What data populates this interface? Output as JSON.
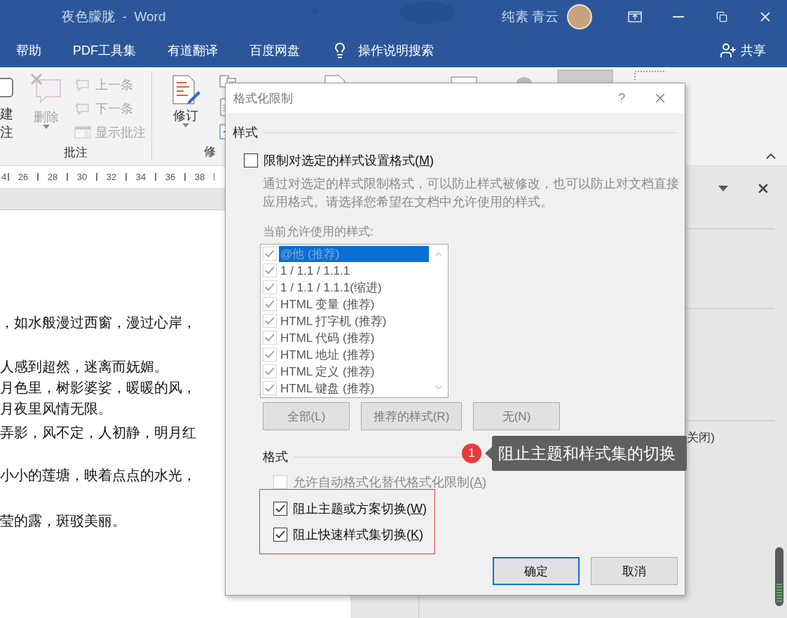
{
  "window": {
    "title": "夜色朦胧",
    "separator": "-",
    "app": "Word",
    "user": "纯素 青云"
  },
  "menu": [
    {
      "label": "帮助"
    },
    {
      "label": "PDF工具集"
    },
    {
      "label": "有道翻译"
    },
    {
      "label": "百度网盘"
    }
  ],
  "search": {
    "label": "操作说明搜索"
  },
  "share": {
    "label": "共享"
  },
  "ribbon": {
    "new_comment": {
      "lines": [
        "建",
        "注"
      ]
    },
    "delete": {
      "label": "删除",
      "disabled": true
    },
    "nav": [
      {
        "label": "上一条",
        "disabled": true
      },
      {
        "label": "下一条",
        "disabled": true
      },
      {
        "label": "显示批注",
        "disabled": true
      }
    ],
    "track": {
      "label": "修订"
    },
    "groups": [
      {
        "label": "批注"
      },
      {
        "label": "修"
      }
    ]
  },
  "ruler": [
    "4",
    "26",
    "28",
    "30",
    "32",
    "34",
    "36",
    "38"
  ],
  "document": {
    "lines": [
      {
        "text": "，如水般漫过西窗，漫过心岸，"
      },
      {
        "text": "人感到超然，迷离而妩媚。"
      },
      {
        "text": "月色里，树影婆娑，暖暖的风，"
      },
      {
        "text": "月夜里风情无限。"
      },
      {
        "text": "弄影，风不定，人初静，明月红"
      },
      {
        "text": "小小的莲塘，映着点点的水光，"
      },
      {
        "text": "莹的露，斑驳美丽。"
      }
    ]
  },
  "task_pane": {
    "text": "关闭)"
  },
  "dialog": {
    "title": "格式化限制",
    "help": "?",
    "styles": {
      "heading": "样式",
      "limit": {
        "label": "限制对选定的样式设置格式(",
        "hotkey": "M",
        "tail": ")",
        "checked": false
      },
      "description": "通过对选定的样式限制格式，可以防止样式被修改，也可以防止对文档直接应用格式。请选择您希望在文档中允许使用的样式。",
      "list_label": "当前允许使用的样式:",
      "items": [
        {
          "label": "@他 (推荐)",
          "checked": true,
          "selected": true
        },
        {
          "label": "1 / 1.1 / 1.1.1",
          "checked": true,
          "selected": false
        },
        {
          "label": "1 / 1.1 / 1.1.1(缩进)",
          "checked": true,
          "selected": false
        },
        {
          "label": "HTML 变量 (推荐)",
          "checked": true,
          "selected": false
        },
        {
          "label": "HTML 打字机 (推荐)",
          "checked": true,
          "selected": false
        },
        {
          "label": "HTML 代码 (推荐)",
          "checked": true,
          "selected": false
        },
        {
          "label": "HTML 地址 (推荐)",
          "checked": true,
          "selected": false
        },
        {
          "label": "HTML 定义 (推荐)",
          "checked": true,
          "selected": false
        },
        {
          "label": "HTML 键盘 (推荐)",
          "checked": true,
          "selected": false
        }
      ],
      "buttons": [
        {
          "label": "全部(L)",
          "disabled": true
        },
        {
          "label": "推荐的样式(R)",
          "disabled": true
        },
        {
          "label": "无(N)",
          "disabled": true
        }
      ]
    },
    "format": {
      "heading": "格式",
      "options": [
        {
          "label": "允许自动格式化替代格式化限制(",
          "hotkey": "A",
          "tail": ")",
          "checked": false,
          "disabled": true
        },
        {
          "label": "阻止主题或方案切换(",
          "hotkey": "W",
          "tail": ")",
          "checked": true,
          "disabled": false
        },
        {
          "label": "阻止快速样式集切换(",
          "hotkey": "K",
          "tail": ")",
          "checked": true,
          "disabled": false
        }
      ]
    },
    "actions": [
      {
        "label": "确定",
        "default": true
      },
      {
        "label": "取消",
        "default": false
      }
    ]
  },
  "callout": {
    "number": "1",
    "text": "阻止主题和样式集的切换"
  }
}
